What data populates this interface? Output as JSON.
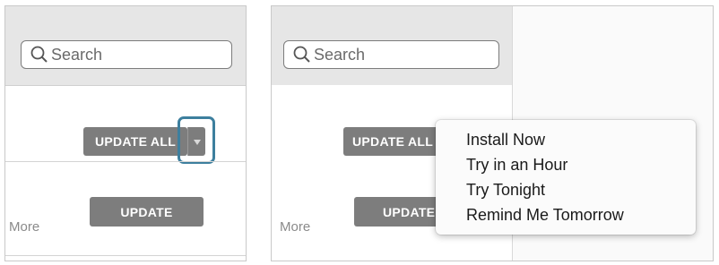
{
  "left_panel": {
    "search": {
      "placeholder": "Search",
      "value": ""
    },
    "update_all_label": "UPDATE ALL",
    "update_label": "UPDATE",
    "more_label": "More"
  },
  "right_panel": {
    "search": {
      "placeholder": "Search",
      "value": ""
    },
    "update_all_label": "UPDATE ALL",
    "update_label": "UPDATE",
    "more_label": "More",
    "menu": {
      "items": [
        "Install Now",
        "Try in an Hour",
        "Try Tonight",
        "Remind Me Tomorrow"
      ]
    }
  },
  "colors": {
    "highlight": "#3d7f9e",
    "button": "#7d7d7d",
    "toolbar": "#e6e6e6"
  },
  "icons": {
    "search": "magnifier-icon",
    "dropdown": "triangle-down-icon"
  }
}
